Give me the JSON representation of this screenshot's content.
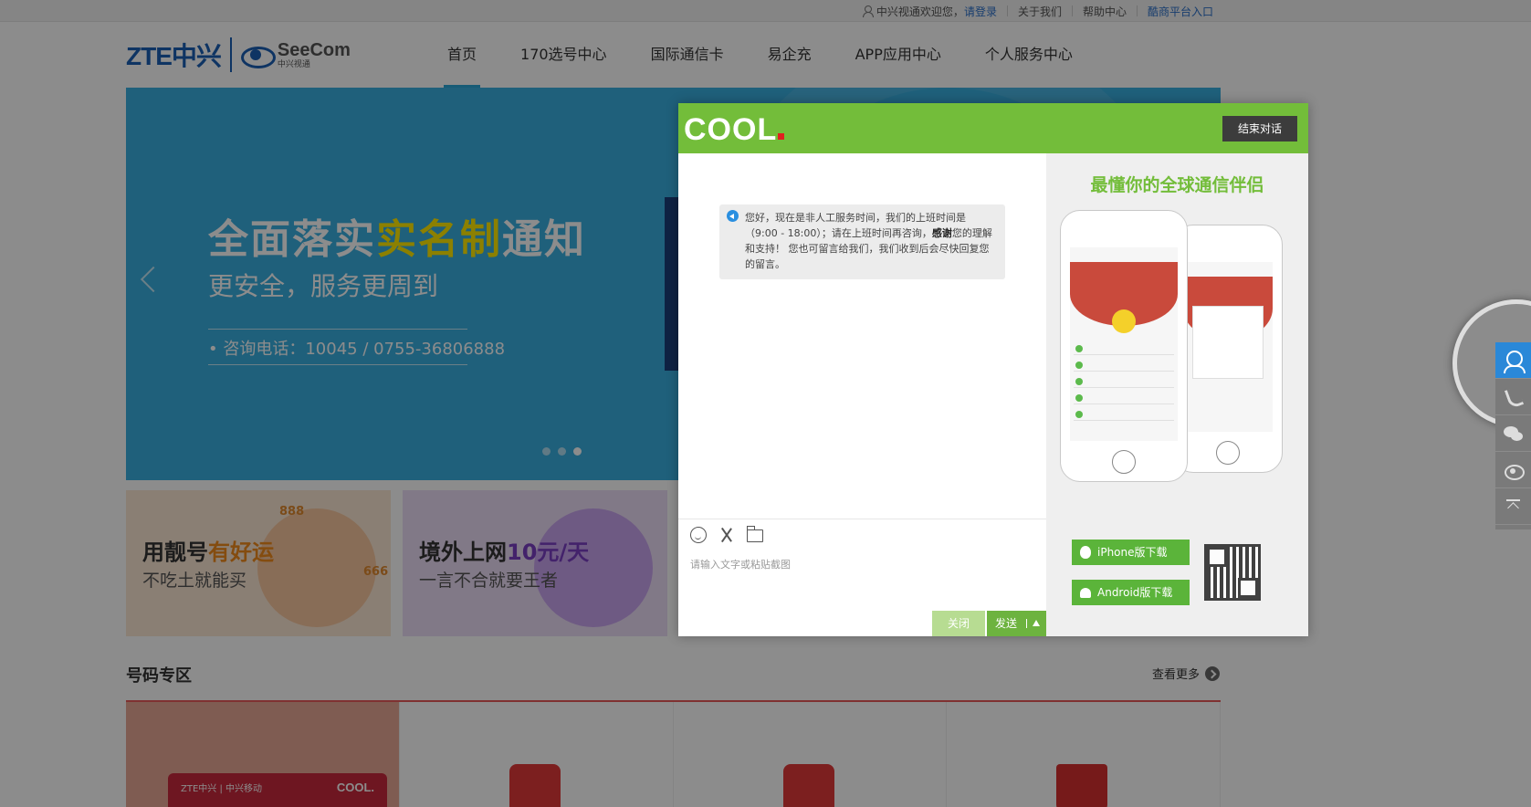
{
  "topbar": {
    "welcome": "中兴视通欢迎您，",
    "login": "请登录",
    "about": "关于我们",
    "help": "帮助中心",
    "merchant": "酷商平台入口"
  },
  "header": {
    "logo_zte": "ZTE中兴",
    "logo_seecom": "SeeCom",
    "logo_seecom_cn": "中兴视通",
    "nav": [
      "首页",
      "170选号中心",
      "国际通信卡",
      "易企充",
      "APP应用中心",
      "个人服务中心"
    ]
  },
  "banner": {
    "title_a": "全面落实",
    "title_hl": "实名制",
    "title_b": "通知",
    "subtitle": "更安全，服务更周到",
    "phone": "• 咨询电话：10045 / 0755-36806888",
    "slides": 3,
    "active_slide": 3
  },
  "promos": [
    {
      "title_a": "用靓号",
      "title_hl": "有好运",
      "sub": "不吃土就能买",
      "num1": "888",
      "num2": "666"
    },
    {
      "title_a": "境外上网",
      "title_hl": "10元/天",
      "sub": "一言不合就要王者"
    }
  ],
  "section": {
    "title": "号码专区",
    "more": "查看更多",
    "card_brand": "COOL.",
    "card_text": "ZTE中兴 | 中兴移动"
  },
  "chat": {
    "logo": "COOL",
    "end_label": "结束对话",
    "message_a": "您好，现在是非人工服务时间，我们的上班时间是（9:00 - 18:00）；请在上班时间再咨询，",
    "message_bold": "感谢",
    "message_b": "您的理解和支持！ 您也可留言给我们，我们收到后会尽快回复您的留言。",
    "input_placeholder": "请输入文字或粘贴截图",
    "close_label": "关闭",
    "send_label": "发送",
    "side_title": "最懂你的全球通信伴侣",
    "ios_label": "iPhone版下载",
    "android_label": "Android版下载"
  },
  "colors": {
    "green": "#73bd3a",
    "banner_blue": "#3aafe0",
    "accent_blue": "#2a88d8",
    "section_red": "#e85a5a"
  }
}
